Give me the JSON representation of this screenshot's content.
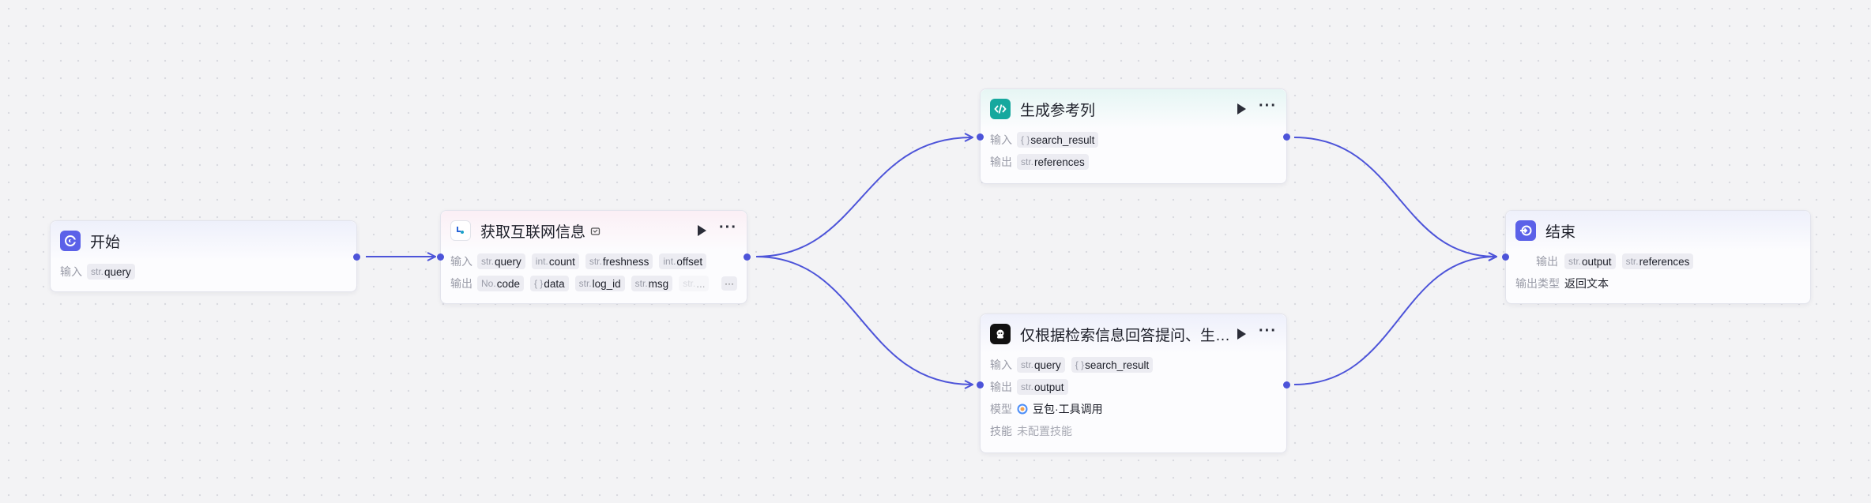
{
  "colors": {
    "edge": "#4d54d9",
    "start_icon": "#5b61e8",
    "code_icon": "#16a89e",
    "llm_icon": "#111111",
    "end_icon": "#5b61e8"
  },
  "start": {
    "title": "开始",
    "input_label": "输入",
    "inputs": [
      {
        "type": "str.",
        "name": "query"
      }
    ]
  },
  "search": {
    "title": "获取互联网信息",
    "input_label": "输入",
    "output_label": "输出",
    "inputs": [
      {
        "type": "str.",
        "name": "query"
      },
      {
        "type": "int.",
        "name": "count"
      },
      {
        "type": "str.",
        "name": "freshness"
      },
      {
        "type": "int.",
        "name": "offset"
      }
    ],
    "outputs": [
      {
        "type": "No.",
        "name": "code"
      },
      {
        "type": "{ }",
        "name": "data"
      },
      {
        "type": "str.",
        "name": "log_id"
      },
      {
        "type": "str.",
        "name": "msg"
      },
      {
        "type": "str.",
        "name": "..."
      }
    ],
    "more_label": "···"
  },
  "code": {
    "title": "生成参考列",
    "input_label": "输入",
    "output_label": "输出",
    "inputs": [
      {
        "type": "{ }",
        "name": "search_result"
      }
    ],
    "outputs": [
      {
        "type": "str.",
        "name": "references"
      }
    ]
  },
  "llm": {
    "title": "仅根据检索信息回答提问、生成...",
    "input_label": "输入",
    "output_label": "输出",
    "model_label": "模型",
    "skill_label": "技能",
    "inputs": [
      {
        "type": "str.",
        "name": "query"
      },
      {
        "type": "{ }",
        "name": "search_result"
      }
    ],
    "outputs": [
      {
        "type": "str.",
        "name": "output"
      }
    ],
    "model": "豆包·工具调用",
    "skill": "未配置技能"
  },
  "end": {
    "title": "结束",
    "output_label": "输出",
    "output_type_label": "输出类型",
    "outputs": [
      {
        "type": "str.",
        "name": "output"
      },
      {
        "type": "str.",
        "name": "references"
      }
    ],
    "output_type": "返回文本"
  }
}
